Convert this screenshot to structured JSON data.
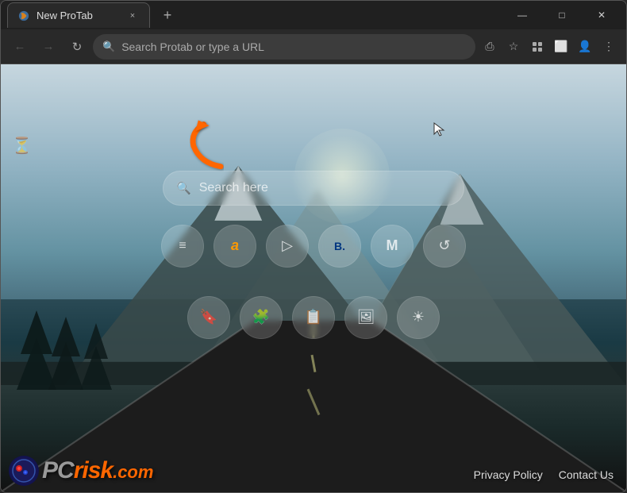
{
  "browser": {
    "tab": {
      "title": "New ProTab",
      "active": true,
      "close_label": "×"
    },
    "new_tab_label": "+",
    "nav": {
      "back_tooltip": "Back",
      "forward_tooltip": "Forward",
      "refresh_tooltip": "Refresh",
      "address_placeholder": "Search Protab or type a URL"
    },
    "window_controls": {
      "minimize": "—",
      "maximize": "□",
      "close": "✕"
    }
  },
  "page": {
    "search_placeholder": "Search here",
    "quick_links_row1": [
      {
        "icon": "≡",
        "label": "Menu"
      },
      {
        "icon": "a",
        "label": "Amazon"
      },
      {
        "icon": "▷",
        "label": "Video"
      },
      {
        "icon": "B.",
        "label": "Booking"
      },
      {
        "icon": "M",
        "label": "Gmail"
      },
      {
        "icon": "↺",
        "label": "History"
      }
    ],
    "quick_links_row2": [
      {
        "icon": "🔖",
        "label": "Bookmarks"
      },
      {
        "icon": "🧩",
        "label": "Extensions"
      },
      {
        "icon": "📋",
        "label": "Tasks"
      },
      {
        "icon": "🖼",
        "label": "Photos"
      },
      {
        "icon": "☀",
        "label": "Brightness"
      }
    ],
    "footer": {
      "privacy_policy": "Privacy Policy",
      "contact_us": "Contact Us"
    },
    "logo": {
      "text_gray": "PC",
      "text_orange": "risk",
      "domain": ".com"
    }
  },
  "icons": {
    "search": "🔍",
    "timer": "⏳",
    "arrow": "orange-arrow-up-left"
  }
}
